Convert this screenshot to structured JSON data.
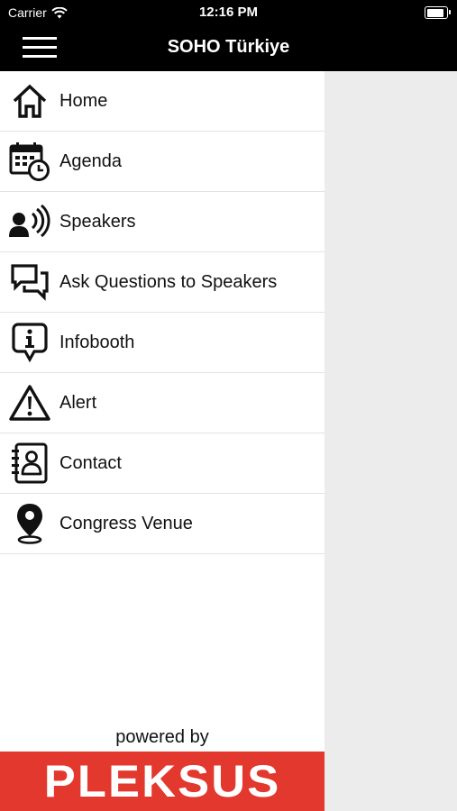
{
  "status_bar": {
    "carrier": "Carrier",
    "time": "12:16 PM"
  },
  "nav": {
    "title": "SOHO Türkiye",
    "menu_icon": "hamburger-icon"
  },
  "menu": [
    {
      "label": "Home",
      "icon": "home-icon"
    },
    {
      "label": "Agenda",
      "icon": "calendar-clock-icon"
    },
    {
      "label": "Speakers",
      "icon": "speaker-person-icon"
    },
    {
      "label": "Ask Questions to Speakers",
      "icon": "chat-bubbles-icon"
    },
    {
      "label": "Infobooth",
      "icon": "info-bubble-icon"
    },
    {
      "label": "Alert",
      "icon": "warning-triangle-icon"
    },
    {
      "label": "Contact",
      "icon": "contact-book-icon"
    },
    {
      "label": "Congress Venue",
      "icon": "location-pin-icon"
    }
  ],
  "footer": {
    "powered_by": "powered by",
    "brand": "PLEKSUS",
    "brand_color": "#e2382d"
  }
}
